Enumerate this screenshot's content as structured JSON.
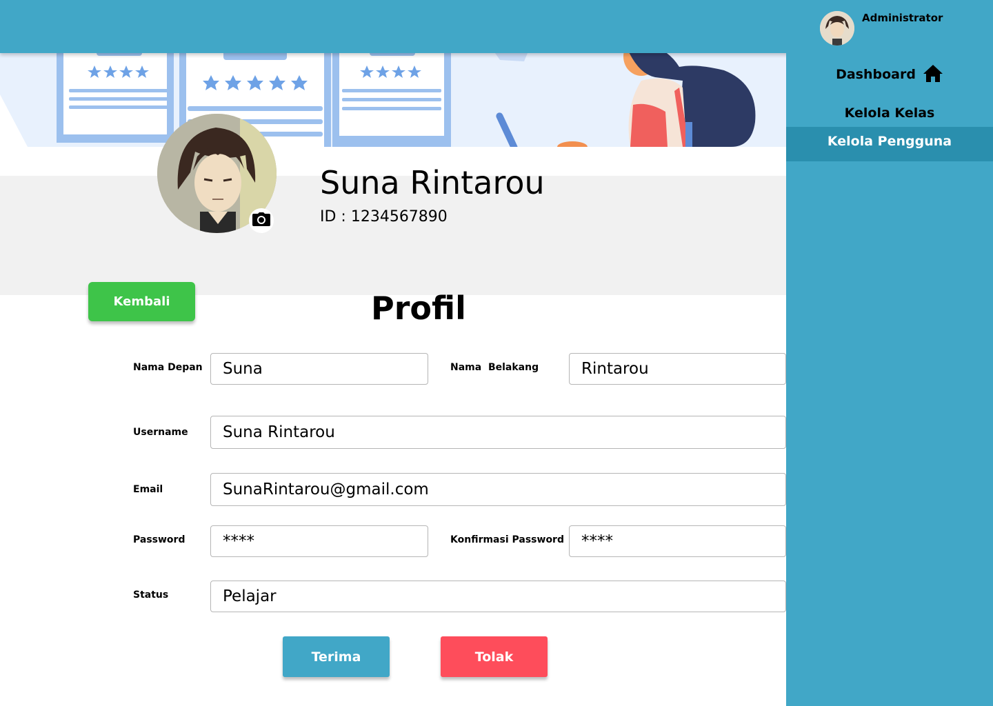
{
  "header": {
    "admin": {
      "name": "Administrator",
      "avatar_icon": "admin-avatar"
    }
  },
  "sidebar": {
    "items": [
      {
        "label": "Dashboard",
        "icon": "home-icon"
      },
      {
        "label": "Kelola Kelas"
      },
      {
        "label": "Kelola Pengguna",
        "active": true
      }
    ]
  },
  "profile": {
    "name": "Suna Rintarou",
    "id_text": "ID : 1234567890",
    "camera_icon": "camera-icon"
  },
  "page": {
    "title": "Profil",
    "back_label": "Kembali"
  },
  "form": {
    "first_name": {
      "label": "Nama Depan",
      "value": "Suna"
    },
    "last_name": {
      "label": "Nama  Belakang",
      "value": "Rintarou"
    },
    "username": {
      "label": "Username",
      "value": "Suna Rintarou"
    },
    "email": {
      "label": "Email",
      "value": "SunaRintarou@gmail.com"
    },
    "password": {
      "label": "Password",
      "value": "****"
    },
    "confirm_password": {
      "label": "Konfirmasi Password",
      "value": "****"
    },
    "status": {
      "label": "Status",
      "value": "Pelajar"
    }
  },
  "actions": {
    "accept_label": "Terima",
    "reject_label": "Tolak"
  },
  "colors": {
    "primary": "#41a7c7",
    "active_nav": "#2a8fae",
    "back_button": "#3ec449",
    "reject_button": "#fe4d5b"
  }
}
